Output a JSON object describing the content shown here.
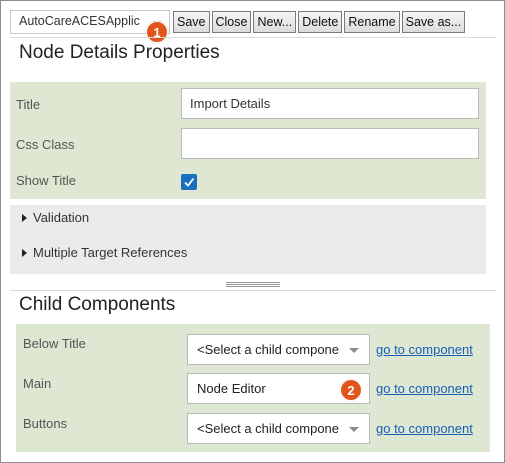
{
  "toolbar": {
    "config_select": "AutoCareACESApplic",
    "buttons": [
      "Save",
      "Close",
      "New...",
      "Delete",
      "Rename",
      "Save as..."
    ]
  },
  "badges": [
    "1",
    "2"
  ],
  "node_details": {
    "heading": "Node Details Properties",
    "title_label": "Title",
    "title_value": "Import Details",
    "css_label": "Css Class",
    "css_value": "",
    "show_title_label": "Show Title",
    "show_title_checked": true
  },
  "collapsibles": [
    "Validation",
    "Multiple Target References"
  ],
  "child_components": {
    "heading": "Child Components",
    "rows": [
      {
        "label": "Below Title",
        "value": "<Select a child compone",
        "is_select": true,
        "link": "go to component"
      },
      {
        "label": "Main",
        "value": "Node Editor",
        "is_select": false,
        "link": "go to component"
      },
      {
        "label": "Buttons",
        "value": "<Select a child compone",
        "is_select": true,
        "link": "go to component"
      }
    ]
  },
  "colors": {
    "badge": "#e2541c",
    "panel_green": "#dde7d2",
    "link": "#1a5fb4",
    "checkbox": "#1a6fbf"
  }
}
